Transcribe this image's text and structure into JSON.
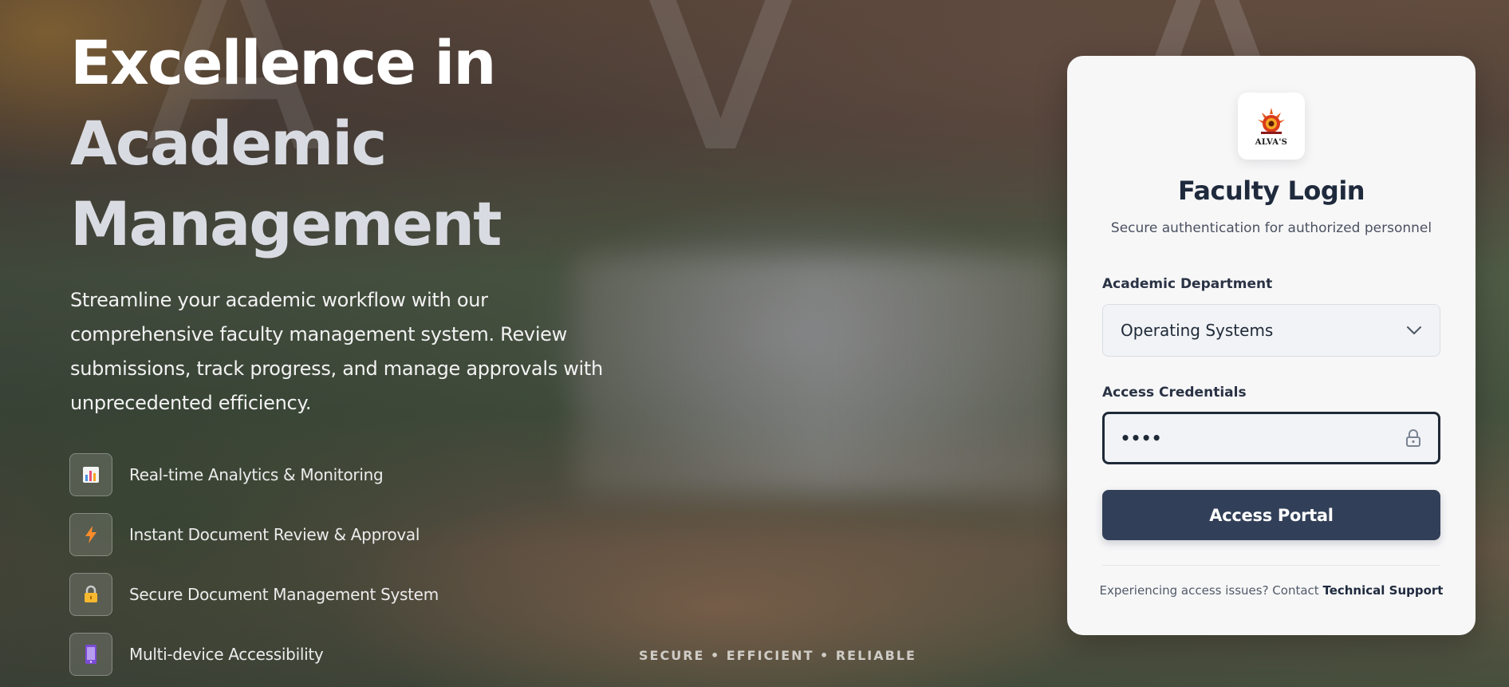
{
  "hero": {
    "title_line1": "Excellence in",
    "title_line2": "Academic",
    "title_line3": "Management",
    "description": "Streamline your academic workflow with our comprehensive faculty management system. Review submissions, track progress, and manage approvals with unprecedented efficiency.",
    "features": [
      {
        "icon": "bar-chart-icon",
        "label": "Real-time Analytics & Monitoring"
      },
      {
        "icon": "lightning-icon",
        "label": "Instant Document Review & Approval"
      },
      {
        "icon": "lock-icon",
        "label": "Secure Document Management System"
      },
      {
        "icon": "mobile-icon",
        "label": "Multi-device Accessibility"
      }
    ],
    "tagline": "SECURE • EFFICIENT • RELIABLE"
  },
  "login": {
    "logo_text": "ALVA'S",
    "title": "Faculty Login",
    "subtitle": "Secure authentication for authorized personnel",
    "department_label": "Academic Department",
    "department_value": "Operating Systems",
    "credentials_label": "Access Credentials",
    "credentials_value": "••••",
    "submit_label": "Access Portal",
    "support_text": "Experiencing access issues? Contact",
    "support_link": "Technical Support"
  },
  "colors": {
    "card_bg": "#f7f7f8",
    "primary_button": "#323f58",
    "title_text": "#1f2a3d"
  }
}
